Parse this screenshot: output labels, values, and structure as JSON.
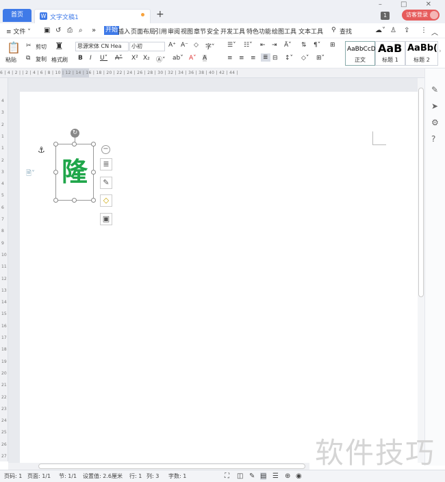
{
  "titlebar": {
    "home_tab": "首页",
    "doc_tab": "文字文稿1",
    "new_tab": "+",
    "badge": "1",
    "login": "访客登录",
    "window_controls": "– □ ✕"
  },
  "menu": {
    "file": "≡ 文件 ˅",
    "items": [
      "开始",
      "插入",
      "页面布局",
      "引用",
      "审阅",
      "视图",
      "章节",
      "安全",
      "开发工具",
      "特色功能",
      "绘图工具",
      "文本工具"
    ],
    "search": "查找"
  },
  "toolbar": {
    "paste": "粘贴",
    "cut": "剪切",
    "copy": "复制",
    "format_painter": "格式刷",
    "font_name": "思源宋体 CN Hea",
    "font_size": "小初",
    "styles": [
      {
        "sample": "AaBbCcD",
        "name": "正文"
      },
      {
        "sample": "AaB",
        "name": "标题 1"
      },
      {
        "sample": "AaBb(",
        "name": "标题 2"
      }
    ]
  },
  "ruler": {
    "ticks": "6 | 4 | 2 |   | 2 | 4 | 6 | 8 | 10 | 12 | 14 | 16 | 18 | 20 | 22 | 24 | 26 | 28 | 30 | 32 | 34 | 36 | 38 | 40 | 42 | 44 |",
    "vticks": [
      "4",
      "3",
      "2",
      "1",
      "1",
      "2",
      "3",
      "4",
      "5",
      "6",
      "7",
      "8",
      "9",
      "10",
      "11",
      "12",
      "13",
      "14",
      "15",
      "16",
      "17",
      "18",
      "19",
      "20",
      "21",
      "22",
      "23",
      "24",
      "25",
      "26",
      "27"
    ]
  },
  "document": {
    "glyph": "隆"
  },
  "status": {
    "page": "页码: 1",
    "pages": "页面: 1/1",
    "section": "节: 1/1",
    "setting": "设置值: 2.6厘米",
    "row": "行: 1",
    "col": "列: 3",
    "words": "字数: 1"
  },
  "watermark": "软件技巧"
}
